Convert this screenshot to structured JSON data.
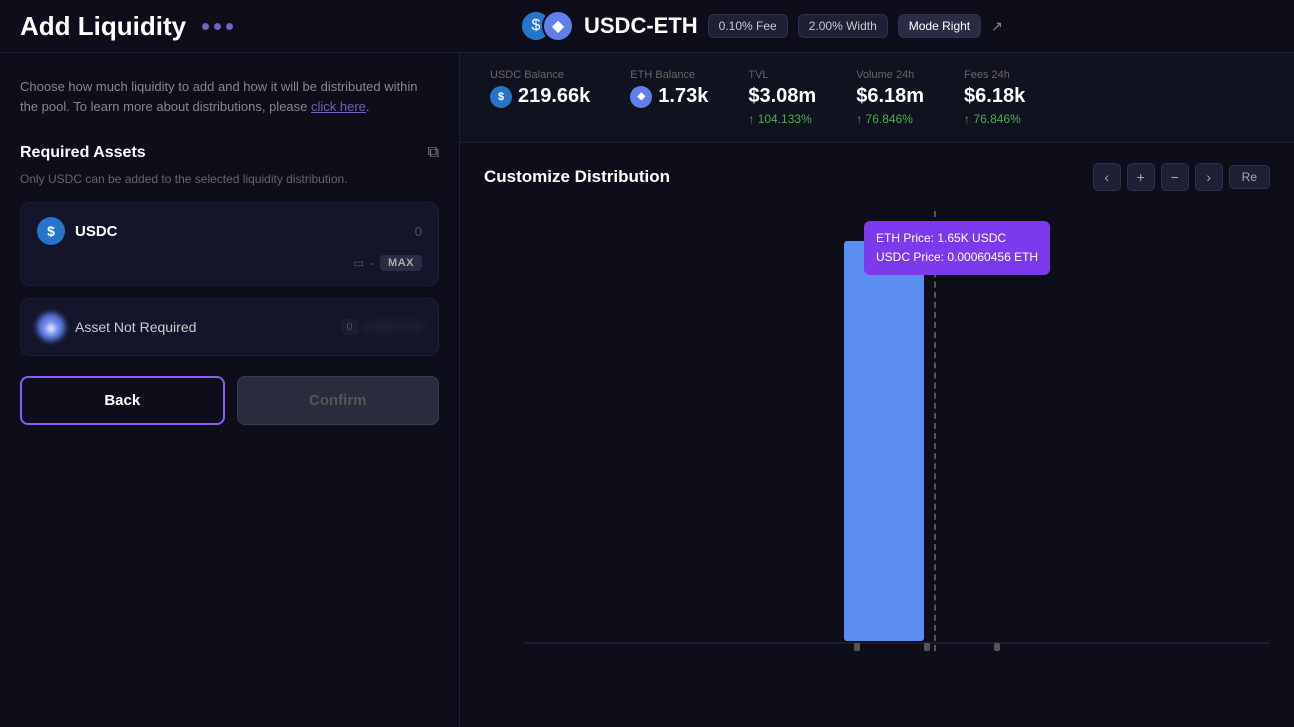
{
  "header": {
    "title": "Add Liquidity",
    "pool_name": "USDC-ETH",
    "fee_badge": "0.10% Fee",
    "width_badge": "2.00% Width",
    "mode_badge": "Mode Right"
  },
  "stats": {
    "usdc_balance_label": "USDC Balance",
    "usdc_balance_value": "219.66k",
    "eth_balance_label": "ETH Balance",
    "eth_balance_value": "1.73k",
    "tvl_label": "TVL",
    "tvl_value": "$3.08m",
    "tvl_change": "104.133%",
    "vol24_label": "Volume 24h",
    "vol24_value": "$6.18m",
    "vol24_change": "76.846%",
    "fees24_label": "Fees 24h",
    "fees24_value": "$6.18k",
    "fees24_change": "76.846%"
  },
  "left": {
    "subtitle": "Choose how much liquidity to add and how it will be distributed within the pool. To learn more about distributions, please ",
    "link_text": "click here",
    "section_title": "Required Assets",
    "asset_note": "Only USDC can be added to the selected liquidity distribution.",
    "usdc_label": "USDC",
    "usdc_zero": "0",
    "max_label": "MAX",
    "asset_not_required_label": "Asset Not Required",
    "back_label": "Back",
    "confirm_label": "Confirm"
  },
  "chart": {
    "title": "Customize Distribution",
    "tooltip_line1": "ETH Price:  1.65K USDC",
    "tooltip_line2": "USDC Price:  0.00060456 ETH",
    "bar_height_pct": 82
  }
}
